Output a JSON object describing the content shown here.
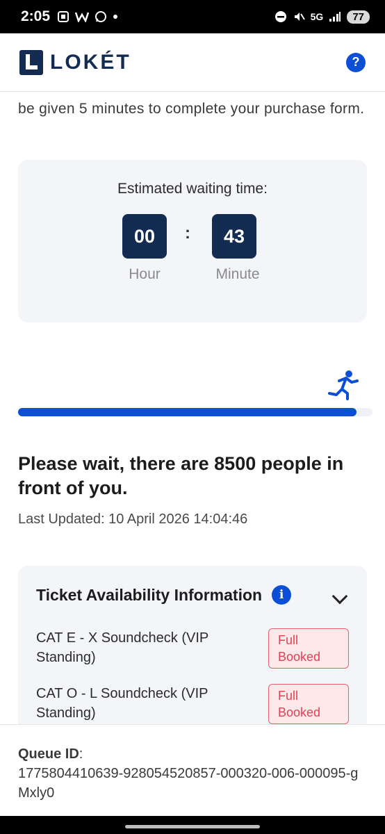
{
  "status_bar": {
    "time": "2:05",
    "left_icons": [
      "screenshot-icon",
      "w-app-icon",
      "whatsapp-icon",
      "dot-icon"
    ],
    "network": "5G",
    "battery": "77"
  },
  "header": {
    "brand": "LOKÉT",
    "help_label": "?"
  },
  "intro": {
    "text": "be given 5 minutes to complete your purchase form."
  },
  "wait": {
    "title": "Estimated waiting time:",
    "hour_value": "00",
    "minute_value": "43",
    "separator": ":",
    "hour_label": "Hour",
    "minute_label": "Minute"
  },
  "progress": {
    "percent": 95.5
  },
  "queue": {
    "heading": "Please wait, there are 8500 people in front of you.",
    "last_updated": "Last Updated: 10 April 2026 14:04:46"
  },
  "availability": {
    "title": "Ticket Availability Information",
    "info_icon": "i",
    "tickets": [
      {
        "name": "CAT E - X Soundcheck (VIP Standing)",
        "status": "Full Booked"
      },
      {
        "name": "CAT O - L Soundcheck (VIP Standing)",
        "status": "Full Booked"
      }
    ]
  },
  "footer": {
    "queue_id_label": "Queue ID",
    "queue_id_colon": ":",
    "queue_id_value": "1775804410639-928054520857-000320-006-000095-gMxly0"
  },
  "colors": {
    "primary": "#0b4fd6",
    "navy": "#152c52",
    "card_bg": "#f3f5f8",
    "badge_red": "#e0434f"
  }
}
